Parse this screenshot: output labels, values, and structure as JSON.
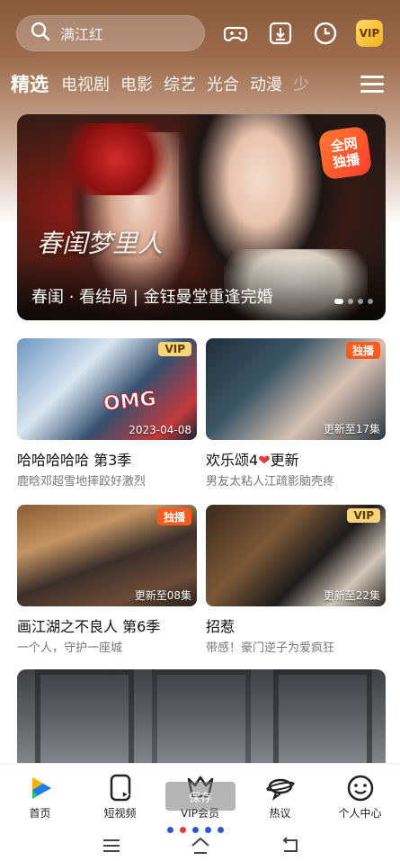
{
  "search": {
    "placeholder": "满江红"
  },
  "top_icons": [
    "gamepad-icon",
    "download-icon",
    "history-icon",
    "vip-icon"
  ],
  "vip_label": "VIP",
  "nav": {
    "tabs": [
      "精选",
      "电视剧",
      "电影",
      "综艺",
      "光合",
      "动漫",
      "少"
    ],
    "active": "精选"
  },
  "hero": {
    "title_art": "春闺梦里人",
    "badge_line1": "全网",
    "badge_line2": "独播",
    "caption": "春闺 · 看结局 | 金钰曼堂重逢完婚"
  },
  "cards": [
    {
      "title": "哈哈哈哈哈 第3季",
      "subtitle": "鹿晗邓超雪地摔跤好激烈",
      "tag": "VIP",
      "overlay": "2023-04-08"
    },
    {
      "title_a": "欢乐颂4",
      "title_b": "更新",
      "subtitle": "男友太粘人江疏影脑壳疼",
      "tag": "独播",
      "overlay": "更新至17集"
    },
    {
      "title": "画江湖之不良人 第6季",
      "subtitle": "一个人，守护一座城",
      "tag": "独播",
      "overlay": "更新至08集"
    },
    {
      "title": "招惹",
      "subtitle": "带感！豪门逆子为爱疯狂",
      "tag": "VIP",
      "overlay": "更新至22集"
    }
  ],
  "bottom_nav": [
    {
      "label": "首页",
      "icon": "home-logo-icon"
    },
    {
      "label": "短视频",
      "icon": "short-video-icon"
    },
    {
      "label": "VIP会员",
      "icon": "vip-member-icon"
    },
    {
      "label": "热议",
      "icon": "discussion-icon"
    },
    {
      "label": "个人中心",
      "icon": "profile-icon"
    }
  ],
  "tooltip": "保存",
  "colors": {
    "accent_red": "#ff5a1f",
    "vip_gold": "#f7d57a",
    "brand_blue": "#2c58c8"
  }
}
